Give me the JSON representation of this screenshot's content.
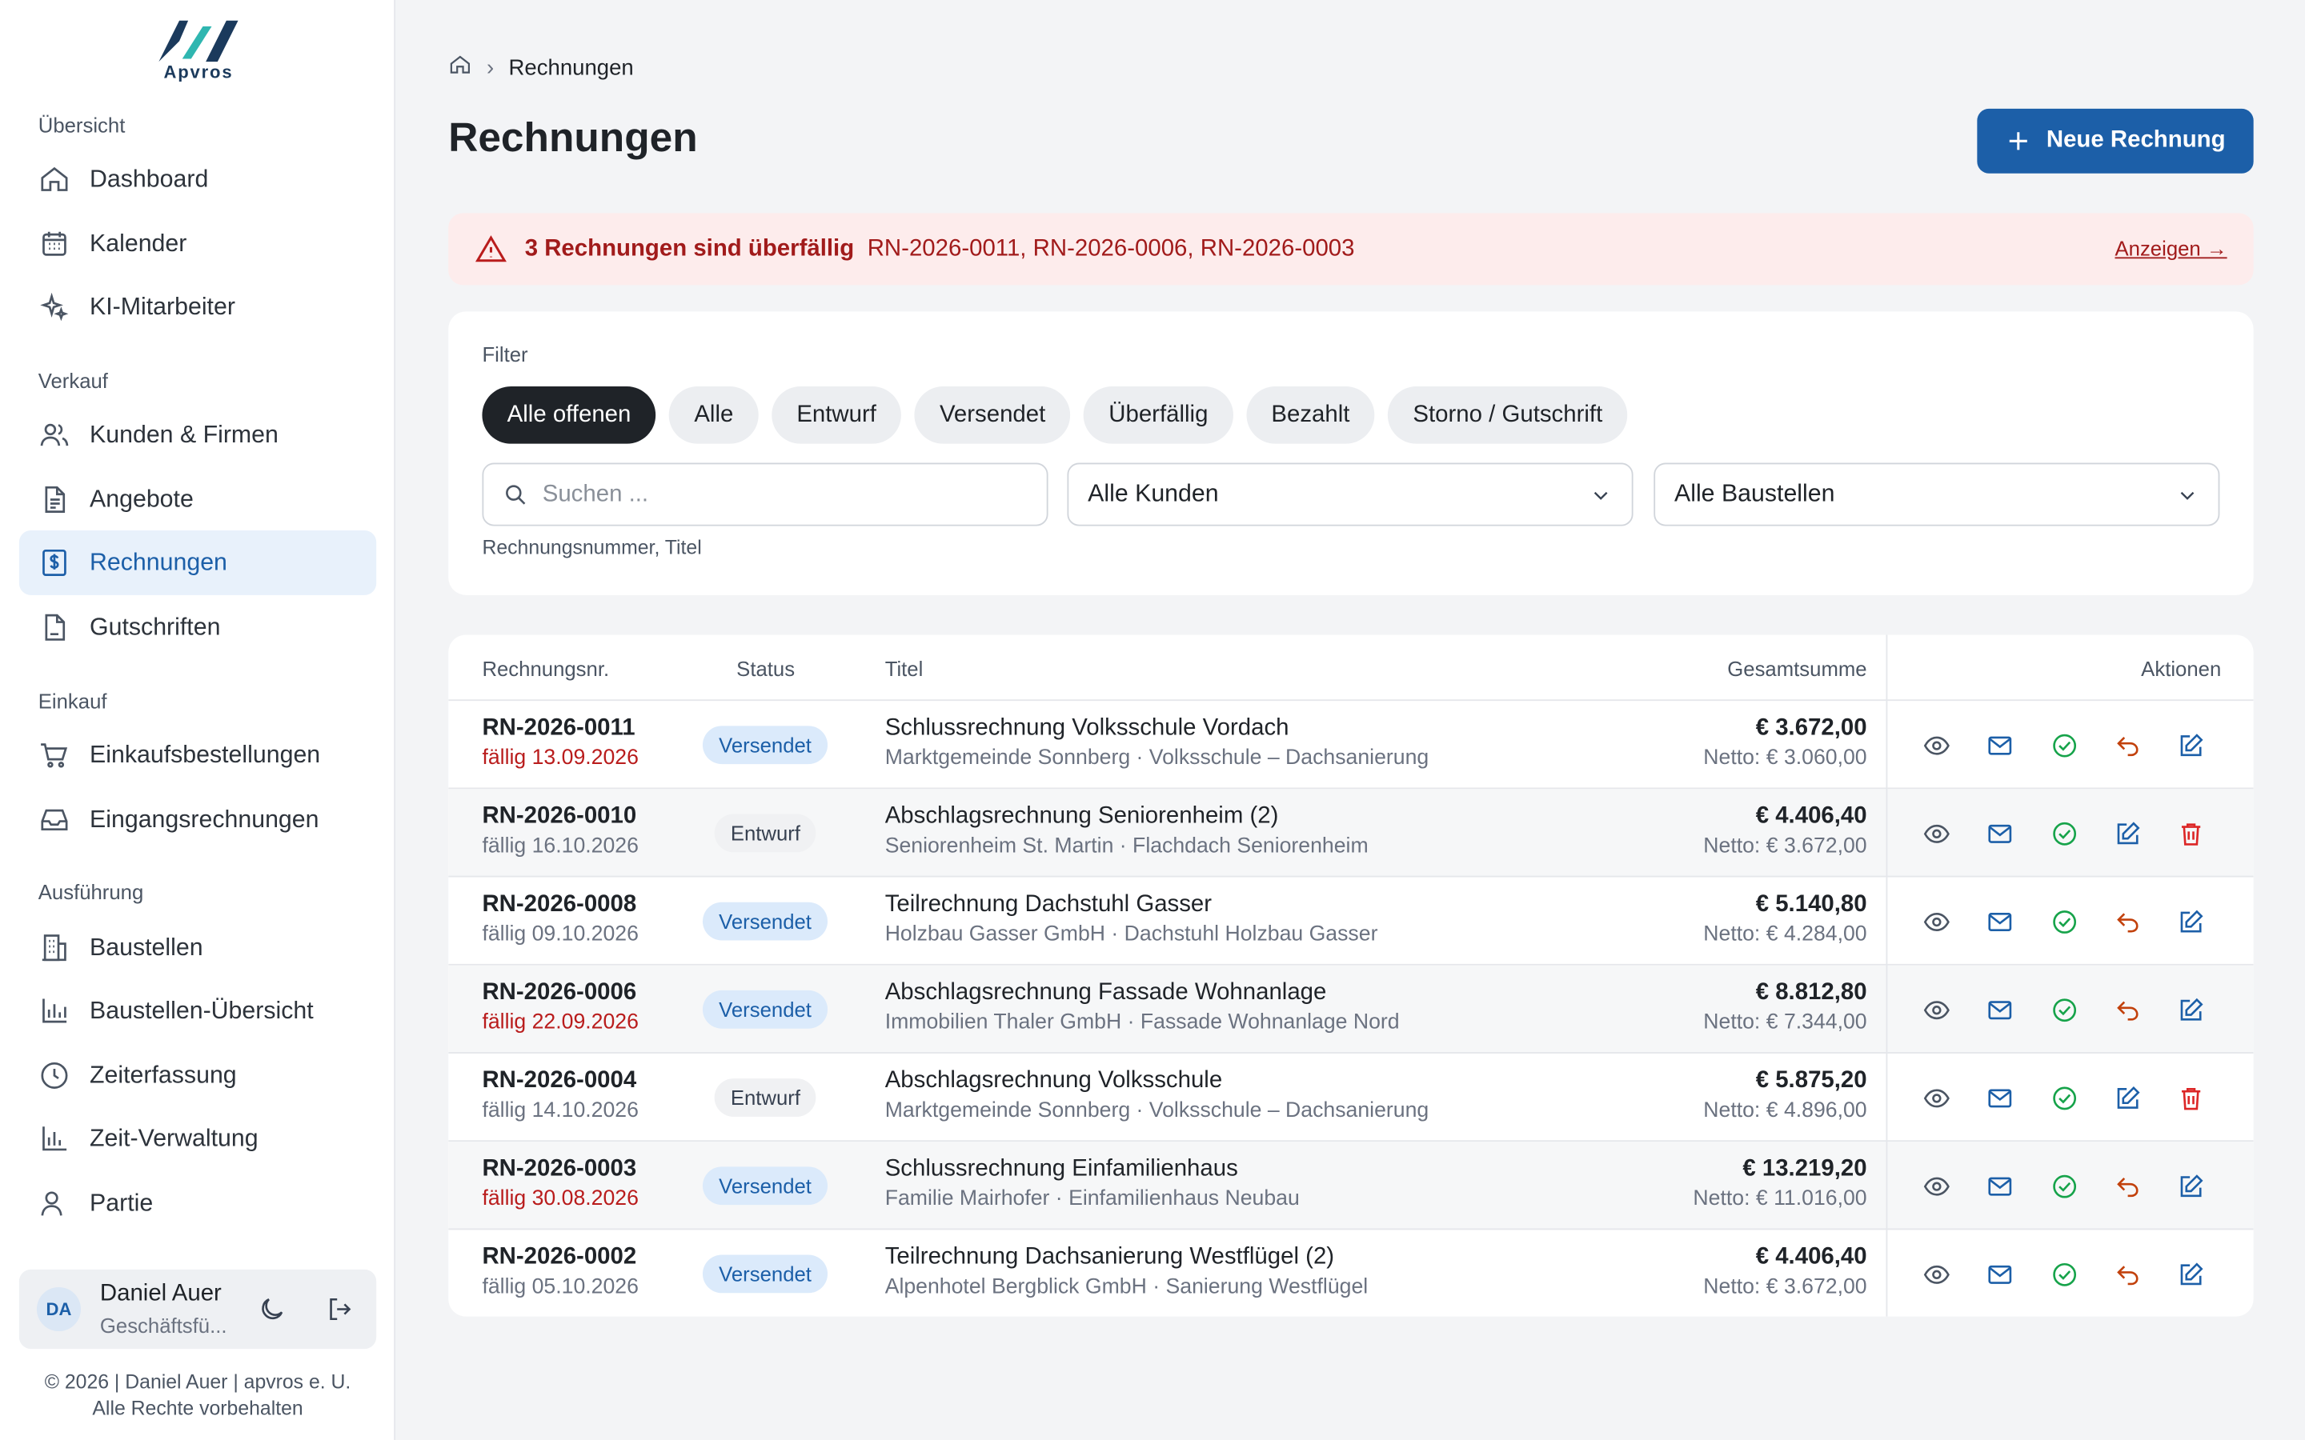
{
  "brand": {
    "name": "Apvros",
    "accent": "#1c5fa8"
  },
  "sidebar": {
    "sections": [
      {
        "label": "Übersicht"
      },
      {
        "label": "Verkauf"
      },
      {
        "label": "Einkauf"
      },
      {
        "label": "Ausführung"
      }
    ],
    "items": [
      {
        "label": "Dashboard",
        "icon": "home-icon"
      },
      {
        "label": "Kalender",
        "icon": "calendar-icon"
      },
      {
        "label": "KI-Mitarbeiter",
        "icon": "sparkles-icon"
      },
      {
        "label": "Kunden & Firmen",
        "icon": "users-icon"
      },
      {
        "label": "Angebote",
        "icon": "document-icon"
      },
      {
        "label": "Rechnungen",
        "icon": "invoice-icon",
        "active": true
      },
      {
        "label": "Gutschriften",
        "icon": "file-icon"
      },
      {
        "label": "Einkaufsbestellungen",
        "icon": "cart-icon"
      },
      {
        "label": "Eingangsrechnungen",
        "icon": "inbox-icon"
      },
      {
        "label": "Baustellen",
        "icon": "building-icon"
      },
      {
        "label": "Baustellen-Übersicht",
        "icon": "bar-chart-icon"
      },
      {
        "label": "Zeiterfassung",
        "icon": "clock-icon"
      },
      {
        "label": "Zeit-Verwaltung",
        "icon": "bar-chart-icon"
      },
      {
        "label": "Partie",
        "icon": "user-icon"
      }
    ],
    "user": {
      "initials": "DA",
      "name": "Daniel Auer",
      "role": "Geschäftsfü..."
    },
    "footer": {
      "line1": "© 2026 | Daniel Auer | apvros e. U.",
      "line2": "Alle Rechte vorbehalten"
    }
  },
  "breadcrumb": {
    "current": "Rechnungen"
  },
  "page": {
    "title": "Rechnungen",
    "new_button": "Neue Rechnung"
  },
  "alert": {
    "title": "3 Rechnungen sind überfällig",
    "list": "RN-2026-0011, RN-2026-0006, RN-2026-0003",
    "link": "Anzeigen →"
  },
  "filter": {
    "label": "Filter",
    "chips": [
      "Alle offenen",
      "Alle",
      "Entwurf",
      "Versendet",
      "Überfällig",
      "Bezahlt",
      "Storno / Gutschrift"
    ],
    "active_chip": "Alle offenen",
    "search_placeholder": "Suchen ...",
    "search_hint": "Rechnungsnummer, Titel",
    "customer_select": "Alle Kunden",
    "site_select": "Alle Baustellen"
  },
  "table": {
    "headers": {
      "nr": "Rechnungsnr.",
      "status": "Status",
      "title": "Titel",
      "sum": "Gesamtsumme",
      "actions": "Aktionen"
    },
    "rows": [
      {
        "nr": "RN-2026-0011",
        "due": "fällig 13.09.2026",
        "overdue": true,
        "status": "Versendet",
        "title": "Schlussrechnung Volksschule Vordach",
        "sub": "Marktgemeinde Sonnberg · Volksschule – Dachsanierung",
        "sum": "€ 3.672,00",
        "net": "Netto: € 3.060,00",
        "draft": false
      },
      {
        "nr": "RN-2026-0010",
        "due": "fällig 16.10.2026",
        "overdue": false,
        "status": "Entwurf",
        "title": "Abschlagsrechnung Seniorenheim (2)",
        "sub": "Seniorenheim St. Martin · Flachdach Seniorenheim",
        "sum": "€ 4.406,40",
        "net": "Netto: € 3.672,00",
        "draft": true
      },
      {
        "nr": "RN-2026-0008",
        "due": "fällig 09.10.2026",
        "overdue": false,
        "status": "Versendet",
        "title": "Teilrechnung Dachstuhl Gasser",
        "sub": "Holzbau Gasser GmbH · Dachstuhl Holzbau Gasser",
        "sum": "€ 5.140,80",
        "net": "Netto: € 4.284,00",
        "draft": false
      },
      {
        "nr": "RN-2026-0006",
        "due": "fällig 22.09.2026",
        "overdue": true,
        "status": "Versendet",
        "title": "Abschlagsrechnung Fassade Wohnanlage",
        "sub": "Immobilien Thaler GmbH · Fassade Wohnanlage Nord",
        "sum": "€ 8.812,80",
        "net": "Netto: € 7.344,00",
        "draft": false
      },
      {
        "nr": "RN-2026-0004",
        "due": "fällig 14.10.2026",
        "overdue": false,
        "status": "Entwurf",
        "title": "Abschlagsrechnung Volksschule",
        "sub": "Marktgemeinde Sonnberg · Volksschule – Dachsanierung",
        "sum": "€ 5.875,20",
        "net": "Netto: € 4.896,00",
        "draft": true
      },
      {
        "nr": "RN-2026-0003",
        "due": "fällig 30.08.2026",
        "overdue": true,
        "status": "Versendet",
        "title": "Schlussrechnung Einfamilienhaus",
        "sub": "Familie Mairhofer · Einfamilienhaus Neubau",
        "sum": "€ 13.219,20",
        "net": "Netto: € 11.016,00",
        "draft": false
      },
      {
        "nr": "RN-2026-0002",
        "due": "fällig 05.10.2026",
        "overdue": false,
        "status": "Versendet",
        "title": "Teilrechnung Dachsanierung Westflügel (2)",
        "sub": "Alpenhotel Bergblick GmbH · Sanierung Westflügel",
        "sum": "€ 4.406,40",
        "net": "Netto: € 3.672,00",
        "draft": false
      }
    ]
  }
}
